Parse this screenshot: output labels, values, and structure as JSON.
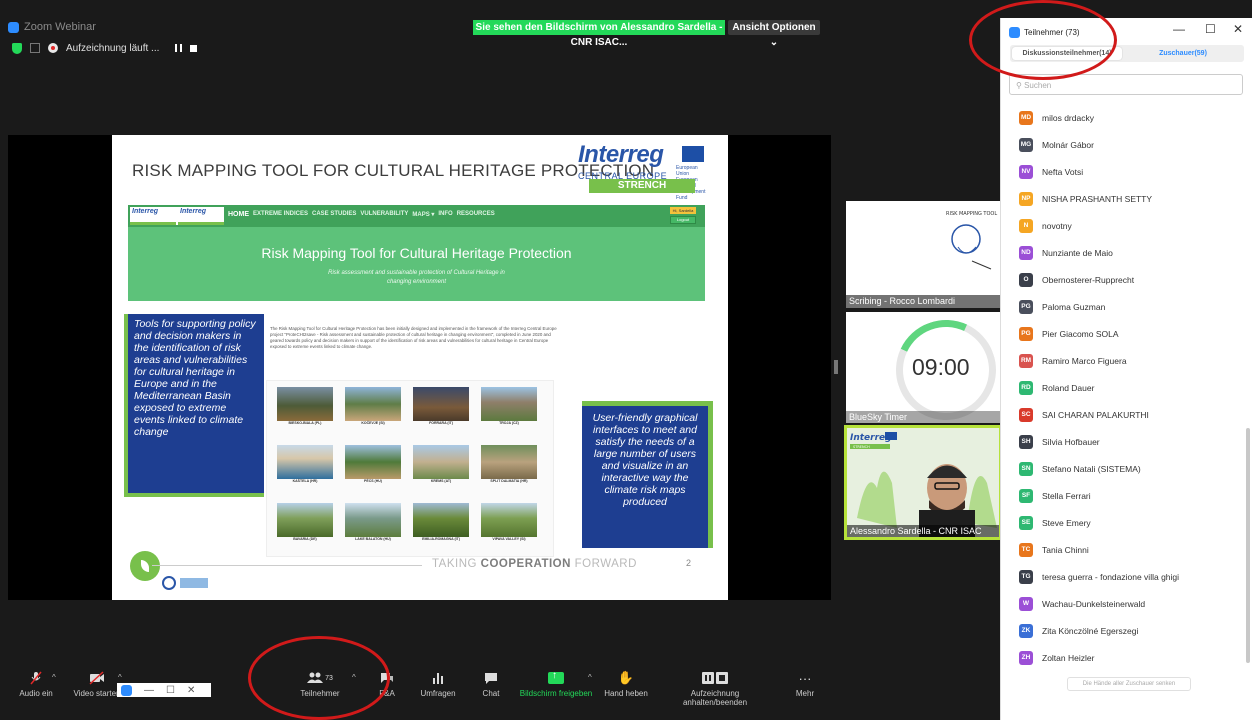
{
  "window": {
    "app_title": "Zoom Webinar",
    "share_banner": "Sie sehen den Bildschirm von Alessandro Sardella - CNR ISAC...",
    "view_options": "Ansicht Optionen",
    "recording_label": "Aufzeichnung läuft ..."
  },
  "slide": {
    "title": "RISK MAPPING TOOL FOR CULTURAL HERITAGE PROTECTION",
    "interreg_word": "Interreg",
    "interreg_region": "CENTRAL EUROPE",
    "interreg_note": "European Union European Regional Development Fund",
    "strench_label": "STRENCH",
    "web_logo_1": "Interreg",
    "web_logo_2": "Interreg",
    "nav_links": [
      "HOME",
      "EXTREME INDICES",
      "CASE STUDIES",
      "VULNERABILITY",
      "MAPS ▾",
      "INFO",
      "RESOURCES"
    ],
    "nav_user": "Hi, Sardella",
    "nav_logout": "Logout",
    "hero_title": "Risk Mapping Tool for Cultural Heritage Protection",
    "hero_subtitle": "Risk assessment and sustainable protection of Cultural Heritage in changing environment",
    "tools_text": "Tools for supporting policy and decision makers in the identification of risk areas and vulnerabilities for cultural heritage in Europe and in the Mediterranean Basin exposed to extreme events linked to climate change",
    "description": "The Risk Mapping Tool for Cultural Heritage Protection has been initially designed and implemented in the framework of the Interreg Central Europe project \"ProteCHt2save - Risk assessment and sustainable protection of cultural heritage in changing environment\", completed in June 2020 and geared towards policy and decision makers in support of the identification of risk areas and vulnerabilities for cultural heritage in Central Europe exposed to extreme events linked to climate change.",
    "gallery": [
      [
        "BIESKO-BIALA (PL)",
        "KOČEVJE (SI)",
        "FORRARA (IT)",
        "TROJA (CZ)"
      ],
      [
        "KAŠTELA (HR)",
        "PÉCS (HU)",
        "KREMS (AT)",
        "SPLIT DALMATIA (HR)"
      ],
      [
        "BAVARIA (DE)",
        "LAKE BALATON (HU)",
        "EMILIA-ROMAGNA (IT)",
        "VIPAVA VALLEY (SI)"
      ]
    ],
    "user_friendly_text": "User-friendly graphical interfaces to meet and satisfy the needs of a large number of users and visualize in an interactive way the climate risk maps produced",
    "slogan_pre": "TAKING",
    "slogan_bold": "COOPERATION",
    "slogan_post": "FORWARD",
    "page_number": "2"
  },
  "tiles": {
    "tile1_name": "Scribing - Rocco Lombardi",
    "tile2_name": "BlueSky Timer",
    "tile2_time": "09:00",
    "tile3_name": "Alessandro Sardella - CNR ISAC (Italy)",
    "tile1_art_title": "RISK MAPPING TOOL",
    "tile3_logo": "Interreg",
    "tile3_sub": "STRENCH"
  },
  "toolbar": {
    "audio": "Audio ein",
    "video": "Video starten",
    "participants": "Teilnehmer",
    "participants_count": "73",
    "qa": "F&A",
    "polls": "Umfragen",
    "chat": "Chat",
    "share": "Bildschirm freigeben",
    "raise_hand": "Hand heben",
    "record": "Aufzeichnung anhalten/beenden",
    "more": "Mehr"
  },
  "panel": {
    "title": "Teilnehmer (73)",
    "tab_panelists": "Diskussionsteilnehmer(14)",
    "tab_attendees": "Zuschauer(59)",
    "search_placeholder": "Suchen",
    "lower_hands": "Die Hände aller Zuschauer senken",
    "participants": [
      {
        "initials": "MD",
        "name": "milos drdacky",
        "color": "#e8761c"
      },
      {
        "initials": "MG",
        "name": "Molnár Gábor",
        "color": "#4a4f5c"
      },
      {
        "initials": "NV",
        "name": "Nefta Votsi",
        "color": "#9b4fd6"
      },
      {
        "initials": "NP",
        "name": "NISHA PRASHANTH SETTY",
        "color": "#f5a623"
      },
      {
        "initials": "N",
        "name": "novotny",
        "color": "#f5a623"
      },
      {
        "initials": "ND",
        "name": "Nunziante de Maio",
        "color": "#9b4fd6"
      },
      {
        "initials": "O",
        "name": "Obernosterer-Rupprecht",
        "color": "#3a3f4a"
      },
      {
        "initials": "PG",
        "name": "Paloma Guzman",
        "color": "#4a4f5c"
      },
      {
        "initials": "PG",
        "name": "Pier Giacomo SOLA",
        "color": "#e8761c"
      },
      {
        "initials": "RM",
        "name": "Ramiro Marco Figuera",
        "color": "#d9534f"
      },
      {
        "initials": "RD",
        "name": "Roland Dauer",
        "color": "#2eb872"
      },
      {
        "initials": "SC",
        "name": "SAI CHARAN PALAKURTHI",
        "color": "#d93a2b"
      },
      {
        "initials": "SH",
        "name": "Silvia Hofbauer",
        "color": "#3a3f4a"
      },
      {
        "initials": "SN",
        "name": "Stefano Natali (SISTEMA)",
        "color": "#2eb872"
      },
      {
        "initials": "SF",
        "name": "Stella Ferrari",
        "color": "#2eb872"
      },
      {
        "initials": "SE",
        "name": "Steve Emery",
        "color": "#2eb872"
      },
      {
        "initials": "TC",
        "name": "Tania Chinni",
        "color": "#e8761c"
      },
      {
        "initials": "TG",
        "name": "teresa guerra - fondazione villa ghigi",
        "color": "#3a3f4a"
      },
      {
        "initials": "W",
        "name": "Wachau-Dunkelsteinerwald",
        "color": "#9b4fd6"
      },
      {
        "initials": "ZK",
        "name": "Zita Könczölné Egerszegi",
        "color": "#3a6fd6"
      },
      {
        "initials": "ZH",
        "name": "Zoltan Heizler",
        "color": "#9b4fd6"
      }
    ]
  }
}
